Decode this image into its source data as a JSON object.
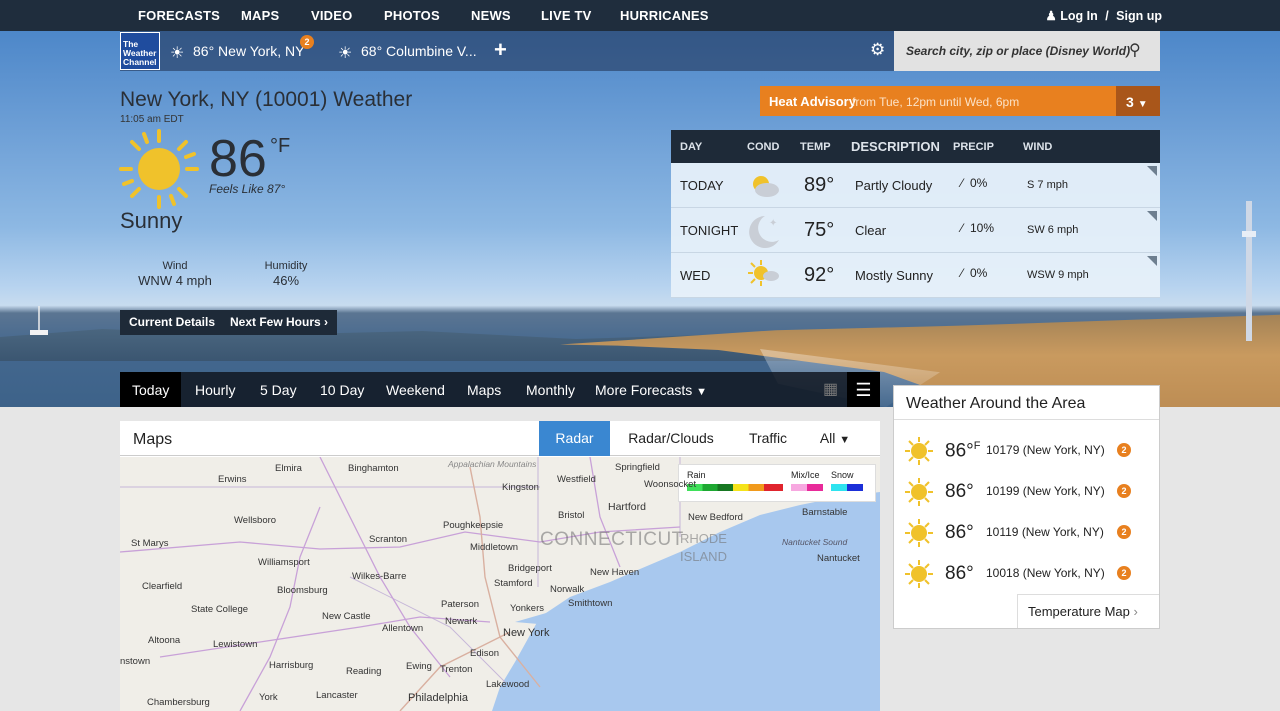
{
  "nav": {
    "items": [
      "FORECASTS",
      "MAPS",
      "VIDEO",
      "PHOTOS",
      "NEWS",
      "LIVE TV",
      "HURRICANES"
    ],
    "login": "Log In",
    "separator": "/",
    "signup": "Sign up"
  },
  "locations": {
    "logo": "The Weather Channel",
    "loc1": "86° New York, NY",
    "loc1_badge": "2",
    "loc2": "68° Columbine V..."
  },
  "search": {
    "placeholder": "Search city, zip or place (Disney World)"
  },
  "current": {
    "title": "New York, NY (10001) Weather",
    "time": "11:05 am EDT",
    "temp": "86",
    "unit": "°F",
    "feels": "Feels Like 87°",
    "condition": "Sunny",
    "wind_label": "Wind",
    "wind_value": "WNW 4 mph",
    "humidity_label": "Humidity",
    "humidity_value": "46%",
    "btn_details": "Current Details",
    "btn_next": "Next Few Hours"
  },
  "advisory": {
    "title": "Heat Advisory",
    "subtitle": "from Tue, 12pm until Wed, 6pm",
    "count": "3"
  },
  "forecast": {
    "headers": {
      "day": "DAY",
      "cond": "COND",
      "temp": "TEMP",
      "desc": "DESCRIPTION",
      "precip": "PRECIP",
      "wind": "WIND"
    },
    "rows": [
      {
        "day": "TODAY",
        "temp": "89°",
        "desc": "Partly Cloudy",
        "precip": "0%",
        "wind": "S 7 mph",
        "icon": "partly-cloudy-icon"
      },
      {
        "day": "TONIGHT",
        "temp": "75°",
        "desc": "Clear",
        "precip": "10%",
        "wind": "SW 6 mph",
        "icon": "moon-icon"
      },
      {
        "day": "WED",
        "temp": "92°",
        "desc": "Mostly Sunny",
        "precip": "0%",
        "wind": "WSW 9 mph",
        "icon": "mostly-sunny-icon"
      }
    ]
  },
  "tabs": [
    "Today",
    "Hourly",
    "5 Day",
    "10 Day",
    "Weekend",
    "Maps",
    "Monthly",
    "More Forecasts"
  ],
  "maps": {
    "title": "Maps",
    "tabs": [
      "Radar",
      "Radar/Clouds",
      "Traffic",
      "All"
    ],
    "legend": {
      "rain": "Rain",
      "mix": "Mix/Ice",
      "snow": "Snow"
    },
    "labels": [
      "Elmira",
      "Binghamton",
      "Appalachian Mountains",
      "Springfield",
      "Erwins",
      "Kingston",
      "Westfield",
      "Woonsocket",
      "Wellsboro",
      "Bristol",
      "Hartford",
      "Poughkeepsie",
      "New Bedford",
      "Barnstable",
      "St Marys",
      "Scranton",
      "Middletown",
      "CONNECTICUT",
      "RHODE",
      "ISLAND",
      "Nantucket Sound",
      "Williamsport",
      "Wilkes-Barre",
      "Bridgeport",
      "Nantucket",
      "New Haven",
      "Clearfield",
      "Bloomsburg",
      "Stamford",
      "Norwalk",
      "State College",
      "Paterson",
      "Yonkers",
      "Smithtown",
      "New Castle",
      "Newark",
      "Allentown",
      "New York",
      "Altoona",
      "Lewistown",
      "Edison",
      "Harrisburg",
      "Reading",
      "Ewing",
      "Trenton",
      "nstown",
      "Lakewood",
      "York",
      "Lancaster",
      "Philadelphia",
      "Chambersburg"
    ]
  },
  "around": {
    "title": "Weather Around the Area",
    "rows": [
      {
        "temp": "86°",
        "unit": "F",
        "loc": "10179 (New York, NY)",
        "badge": "2"
      },
      {
        "temp": "86°",
        "loc": "10199 (New York, NY)",
        "badge": "2"
      },
      {
        "temp": "86°",
        "loc": "10119 (New York, NY)",
        "badge": "2"
      },
      {
        "temp": "86°",
        "loc": "10018 (New York, NY)",
        "badge": "2"
      }
    ],
    "temp_map": "Temperature Map"
  },
  "colors": {
    "accent": "#e8801f",
    "nav_bg": "#1f2d3d",
    "tab_active": "#3a87d1"
  }
}
